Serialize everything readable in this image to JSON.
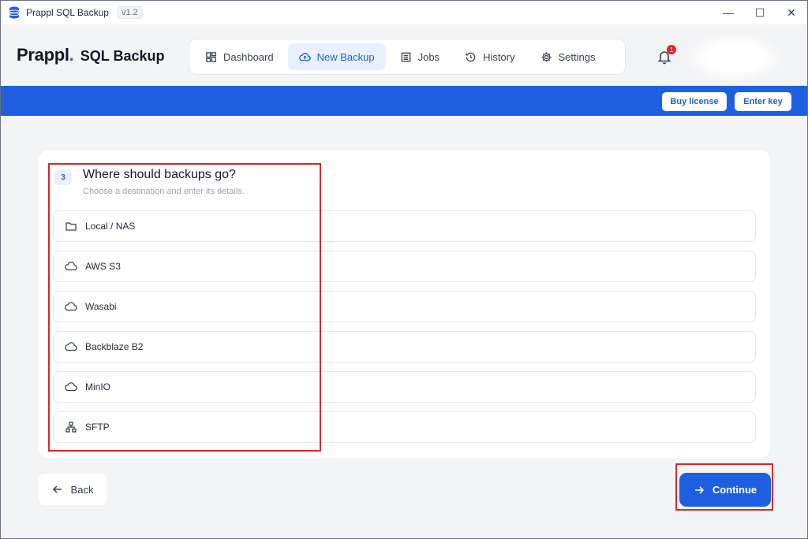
{
  "window": {
    "title": "Prappl SQL Backup",
    "version": "v1.2",
    "controls": {
      "minimize": "—",
      "maximize": "☐",
      "close": "✕"
    }
  },
  "brand": {
    "name": "Prappl",
    "dot": ".",
    "product": "SQL Backup"
  },
  "nav": {
    "items": [
      {
        "label": "Dashboard",
        "icon": "dashboard-icon"
      },
      {
        "label": "New Backup",
        "icon": "cloud-upload-icon",
        "active": true
      },
      {
        "label": "Jobs",
        "icon": "list-icon"
      },
      {
        "label": "History",
        "icon": "history-icon"
      },
      {
        "label": "Settings",
        "icon": "gear-icon"
      }
    ]
  },
  "notifications": {
    "count": "1"
  },
  "banner": {
    "buy_license": "Buy license",
    "enter_key": "Enter key"
  },
  "step": {
    "number": "3",
    "title": "Where should backups go?",
    "subtitle": "Choose a destination and enter its details."
  },
  "destinations": [
    {
      "label": "Local / NAS",
      "icon": "folder-icon"
    },
    {
      "label": "AWS S3",
      "icon": "cloud-icon"
    },
    {
      "label": "Wasabi",
      "icon": "cloud-icon"
    },
    {
      "label": "Backblaze B2",
      "icon": "cloud-icon"
    },
    {
      "label": "MinIO",
      "icon": "cloud-icon"
    },
    {
      "label": "SFTP",
      "icon": "network-icon"
    }
  ],
  "footer": {
    "back": "Back",
    "continue": "Continue"
  },
  "colors": {
    "accent": "#1d5fe0",
    "highlight": "#d62828",
    "badge": "#dc2626"
  }
}
